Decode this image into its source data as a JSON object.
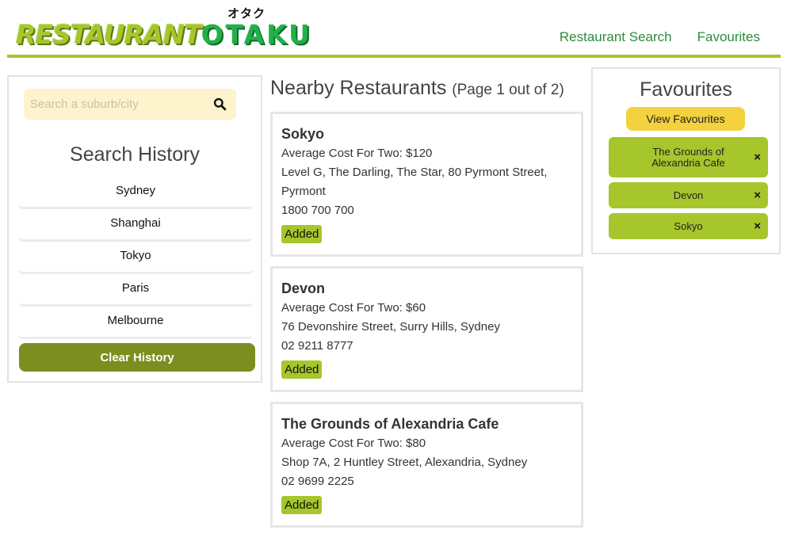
{
  "header": {
    "logo_main": "RESTAURANT",
    "logo_accent": "OTAKU",
    "logo_kana": "オタク",
    "nav": [
      {
        "label": "Restaurant Search"
      },
      {
        "label": "Favourites"
      }
    ]
  },
  "search": {
    "placeholder": "Search a suburb/city",
    "icon": "search-icon"
  },
  "history": {
    "title": "Search History",
    "items": [
      "Sydney",
      "Shanghai",
      "Tokyo",
      "Paris",
      "Melbourne"
    ],
    "clear_label": "Clear History"
  },
  "results": {
    "title": "Nearby Restaurants",
    "page_info": "(Page 1 out of 2)",
    "cards": [
      {
        "name": "Sokyo",
        "cost": "Average Cost For Two: $120",
        "address": "Level G, The Darling, The Star, 80 Pyrmont Street, Pyrmont",
        "phone": "1800 700 700",
        "status": "Added"
      },
      {
        "name": "Devon",
        "cost": "Average Cost For Two: $60",
        "address": "76 Devonshire Street, Surry Hills, Sydney",
        "phone": "02 9211 8777",
        "status": "Added"
      },
      {
        "name": "The Grounds of Alexandria Cafe",
        "cost": "Average Cost For Two: $80",
        "address": "Shop 7A, 2 Huntley Street, Alexandria, Sydney",
        "phone": "02 9699 2225",
        "status": "Added"
      }
    ]
  },
  "favourites": {
    "title": "Favourites",
    "view_label": "View Favourites",
    "remove_symbol": "×",
    "items": [
      "The Grounds of Alexandria Cafe",
      "Devon",
      "Sokyo"
    ]
  },
  "colors": {
    "brand_green": "#a6c62c",
    "dark_olive": "#7c8e1f",
    "nav_green": "#2e8b3c",
    "yellow": "#f3d23e",
    "search_bg": "#fdf3cc"
  }
}
